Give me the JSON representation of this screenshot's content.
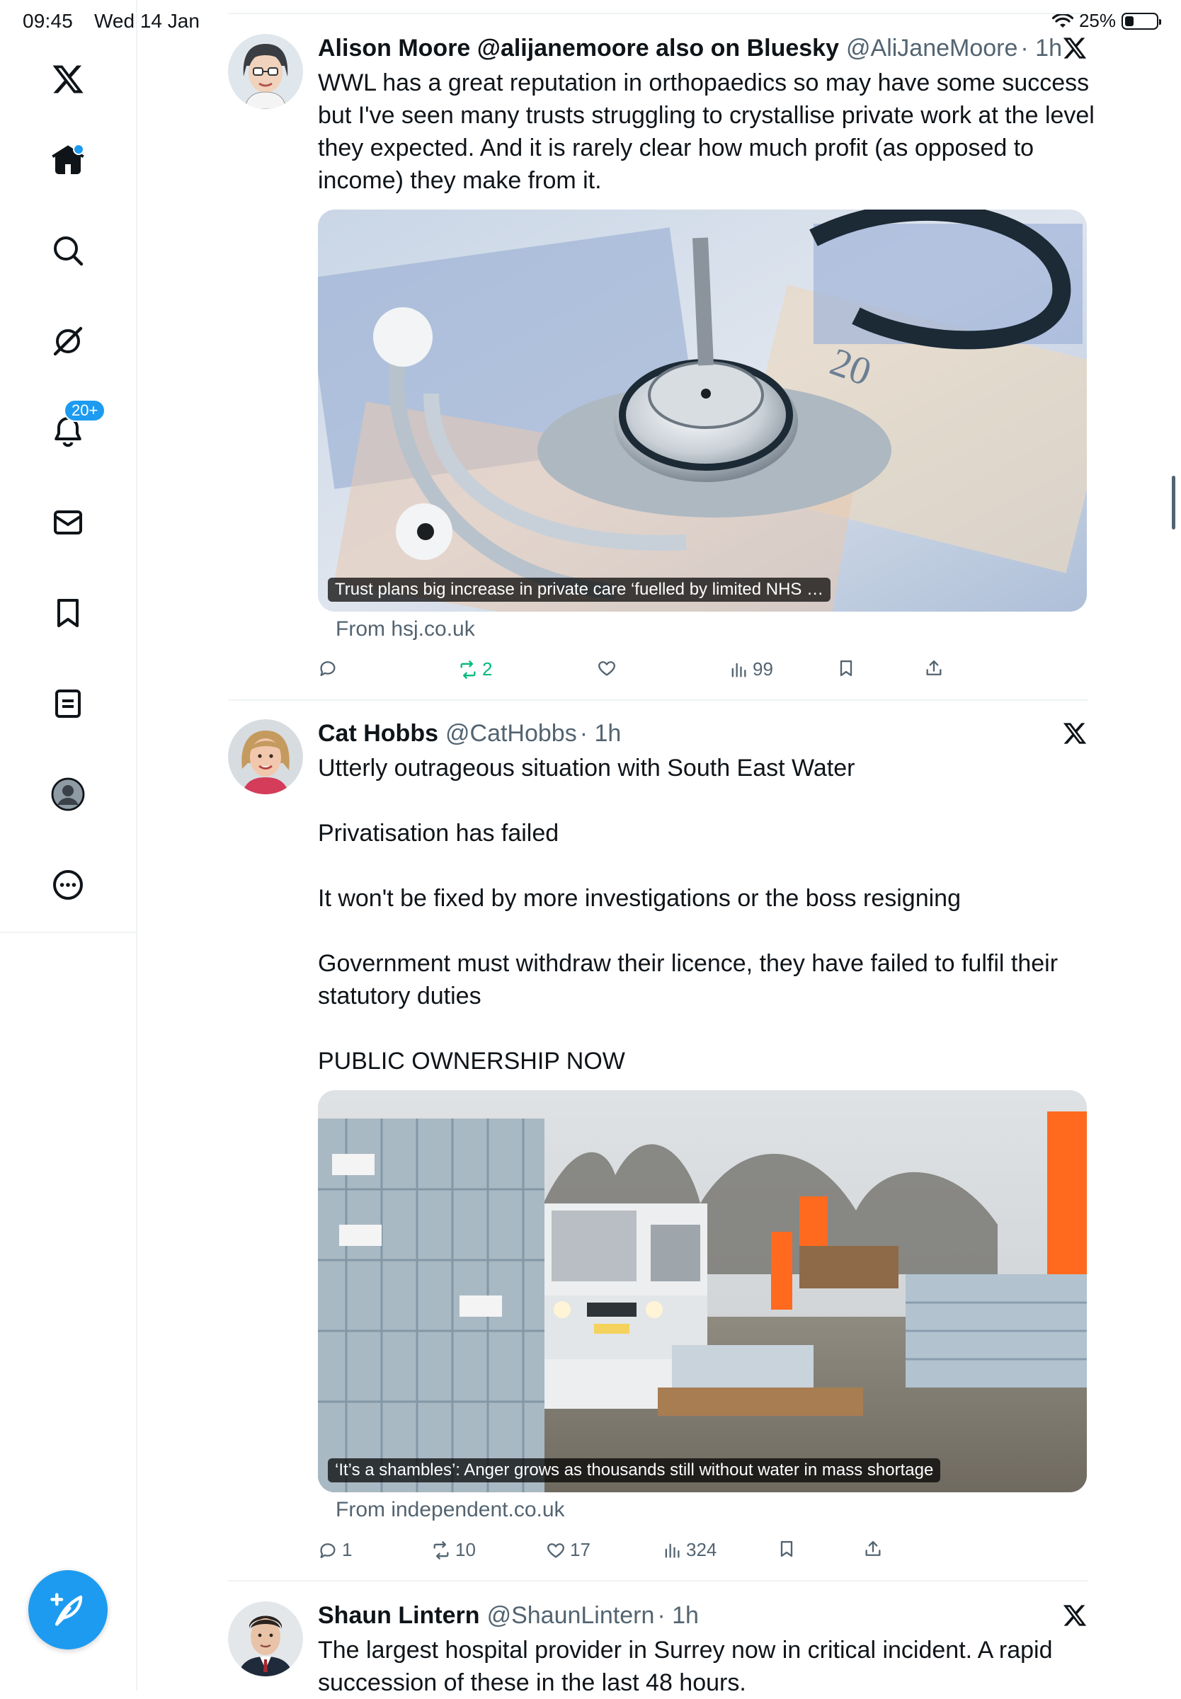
{
  "status_bar": {
    "time": "09:45",
    "date": "Wed 14 Jan",
    "battery": "25%"
  },
  "sidebar": {
    "items": [
      {
        "name": "x-logo-icon"
      },
      {
        "name": "home-icon",
        "has_dot": true
      },
      {
        "name": "search-icon"
      },
      {
        "name": "grok-icon"
      },
      {
        "name": "notifications-icon",
        "badge": "20+"
      },
      {
        "name": "messages-icon"
      },
      {
        "name": "bookmarks-icon"
      },
      {
        "name": "lists-icon"
      },
      {
        "name": "profile-icon"
      },
      {
        "name": "more-icon"
      }
    ],
    "accent": "#1d9bf0"
  },
  "tweets": [
    {
      "name": "Alison Moore @alijanemoore also on Bluesky",
      "handle": "@AliJaneMoore",
      "time": "· 1h",
      "text": "WWL has a great reputation in orthopaedics so may have some success but I've seen many trusts struggling to crystallise private work at the level they expected. And it is rarely clear how much profit (as opposed to income) they make from it.",
      "card_caption": "Trust plans big increase in private care ‘fuelled by limited NHS …",
      "card_from": "From hsj.co.uk",
      "stats": {
        "replies": "",
        "reposts": "2",
        "likes": "",
        "views": "99"
      },
      "repost_color": "#00ba7c"
    },
    {
      "name": "Cat Hobbs",
      "handle": "@CatHobbs",
      "time": "· 1h",
      "text": "Utterly outrageous situation with South East Water\n\nPrivatisation has failed\n\nIt won't be fixed by more investigations or the boss resigning\n\nGovernment must withdraw their licence, they have failed to fulfil their statutory duties\n\nPUBLIC OWNERSHIP NOW",
      "card_caption": "‘It’s a shambles’: Anger grows as thousands still without water in mass shortage",
      "card_from": "From independent.co.uk",
      "stats": {
        "replies": "1",
        "reposts": "10",
        "likes": "17",
        "views": "324"
      }
    },
    {
      "name": "Shaun Lintern",
      "handle": "@ShaunLintern",
      "time": "· 1h",
      "text": "The largest hospital provider in Surrey now in critical incident. A rapid succession of these in the last 48 hours."
    }
  ]
}
